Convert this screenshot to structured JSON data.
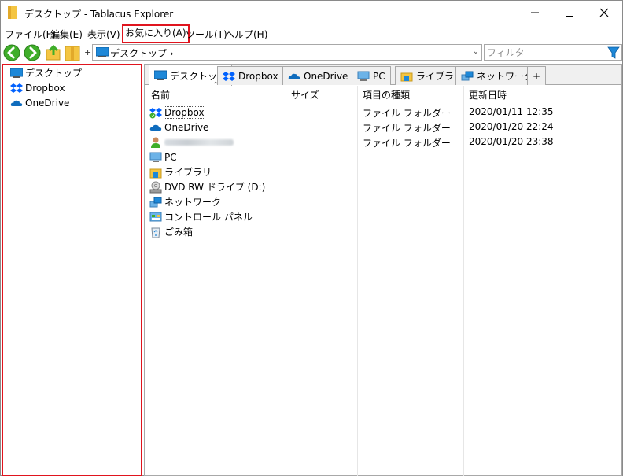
{
  "window": {
    "title": "デスクトップ - Tablacus Explorer"
  },
  "menu": {
    "items": [
      {
        "label": "ファイル(F)"
      },
      {
        "label": "編集(E)"
      },
      {
        "label": "表示(V)"
      },
      {
        "label": "お気に入り(A)",
        "highlighted": true
      },
      {
        "label": "ツール(T)"
      },
      {
        "label": "ヘルプ(H)"
      }
    ]
  },
  "toolbar": {
    "address_text": "デスクトップ ›",
    "filter_placeholder": "フィルタ"
  },
  "tree": {
    "items": [
      {
        "label": "デスクトップ",
        "icon": "desktop-icon"
      },
      {
        "label": "Dropbox",
        "icon": "dropbox-icon"
      },
      {
        "label": "OneDrive",
        "icon": "onedrive-icon"
      }
    ]
  },
  "tabs": {
    "items": [
      {
        "label": "デスクトップ",
        "icon": "desktop-icon",
        "active": true
      },
      {
        "label": "Dropbox",
        "icon": "dropbox-icon"
      },
      {
        "label": "OneDrive",
        "icon": "onedrive-icon"
      },
      {
        "label": "PC",
        "icon": "pc-icon"
      },
      {
        "label": "ライブラリ",
        "icon": "library-icon"
      },
      {
        "label": "ネットワーク",
        "icon": "network-icon"
      }
    ],
    "add_label": "+"
  },
  "list": {
    "columns": {
      "name": "名前",
      "size": "サイズ",
      "type": "項目の種類",
      "modified": "更新日時"
    },
    "rows": [
      {
        "name": "Dropbox",
        "icon": "dropbox-icon",
        "type": "ファイル フォルダー",
        "modified": "2020/01/11 12:35"
      },
      {
        "name": "OneDrive",
        "icon": "onedrive-icon",
        "type": "ファイル フォルダー",
        "modified": "2020/01/20 22:24"
      },
      {
        "name": "",
        "icon": "user-icon",
        "type": "ファイル フォルダー",
        "modified": "2020/01/20 23:38"
      },
      {
        "name": "PC",
        "icon": "pc-icon",
        "type": "",
        "modified": ""
      },
      {
        "name": "ライブラリ",
        "icon": "library-icon",
        "type": "",
        "modified": ""
      },
      {
        "name": "DVD RW ドライブ (D:)",
        "icon": "dvd-drive-icon",
        "type": "",
        "modified": ""
      },
      {
        "name": "ネットワーク",
        "icon": "network-icon",
        "type": "",
        "modified": ""
      },
      {
        "name": "コントロール パネル",
        "icon": "control-panel-icon",
        "type": "",
        "modified": ""
      },
      {
        "name": "ごみ箱",
        "icon": "recycle-bin-icon",
        "type": "",
        "modified": ""
      }
    ]
  },
  "colors": {
    "highlight_border": "#e0141e",
    "nav_green": "#3fae2a",
    "desktop_blue": "#1e88d8",
    "dropbox_blue": "#0061fe",
    "folder_yellow": "#f4c542"
  }
}
